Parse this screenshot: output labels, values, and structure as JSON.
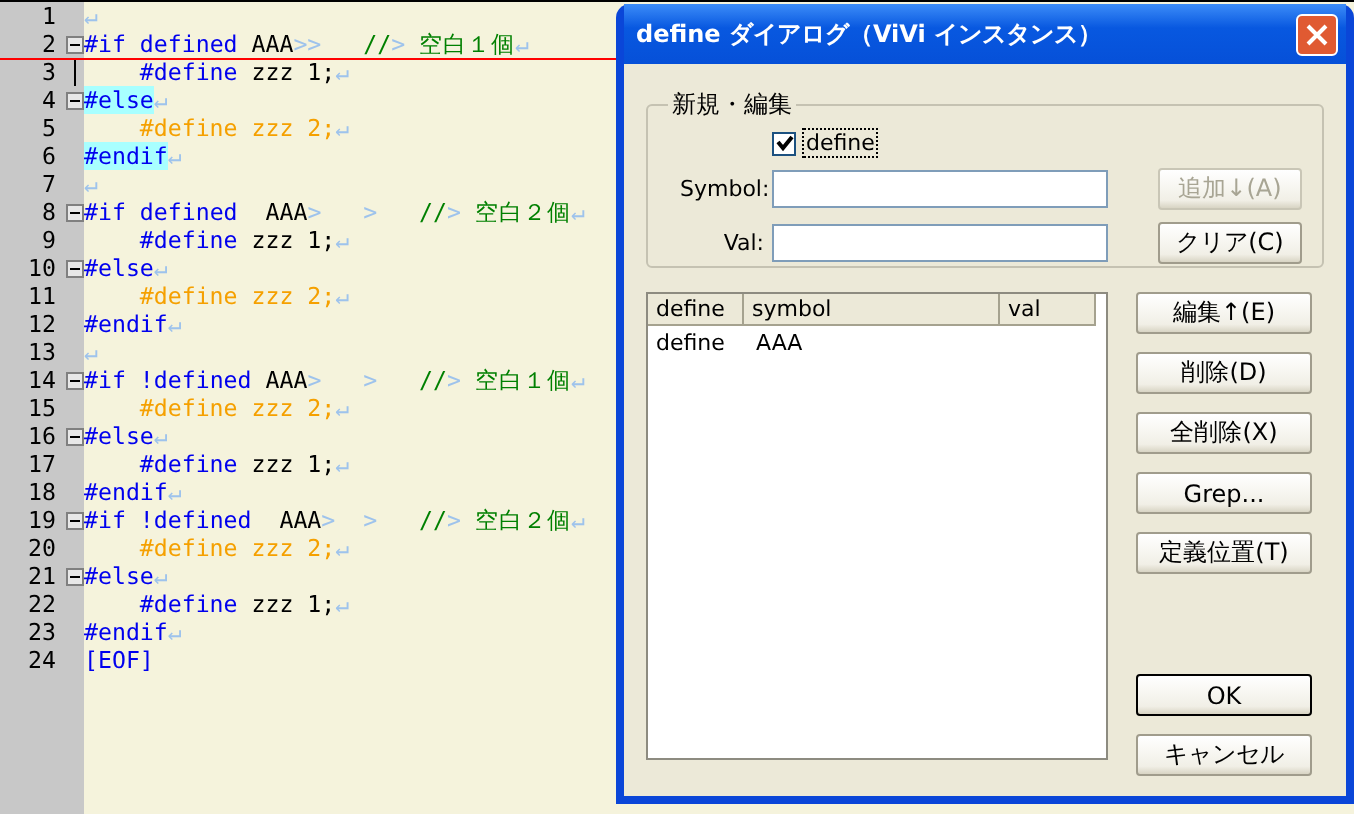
{
  "editor": {
    "lines": [
      {
        "number": "1",
        "fold": false,
        "indent": false,
        "cursor": false,
        "underline": false,
        "segments": [
          {
            "kind": "eol",
            "text": "↵"
          }
        ]
      },
      {
        "number": "2",
        "fold": true,
        "indent": false,
        "cursor": false,
        "underline": true,
        "segments": [
          {
            "kind": "kw",
            "text": "#if defined"
          },
          {
            "kind": "plain",
            "text": " AAA"
          },
          {
            "kind": "tab",
            "text": ">>"
          },
          {
            "kind": "comment",
            "text": "   //"
          },
          {
            "kind": "tab",
            "text": ">"
          },
          {
            "kind": "comment",
            "text": " 空白１個"
          },
          {
            "kind": "eol",
            "text": "↵"
          }
        ]
      },
      {
        "number": "3",
        "fold": false,
        "indent": true,
        "cursor": true,
        "underline": false,
        "segments": [
          {
            "kind": "kw",
            "text": "#define"
          },
          {
            "kind": "plain",
            "text": " zzz 1;"
          },
          {
            "kind": "eol",
            "text": "↵"
          }
        ]
      },
      {
        "number": "4",
        "fold": true,
        "indent": false,
        "cursor": false,
        "underline": false,
        "segments": [
          {
            "kind": "kw",
            "text": "#else",
            "highlight": true
          },
          {
            "kind": "eol",
            "text": "↵"
          }
        ]
      },
      {
        "number": "5",
        "fold": false,
        "indent": true,
        "cursor": false,
        "underline": false,
        "segments": [
          {
            "kind": "off",
            "text": "#define zzz 2;"
          },
          {
            "kind": "eol",
            "text": "↵"
          }
        ]
      },
      {
        "number": "6",
        "fold": false,
        "indent": false,
        "cursor": false,
        "underline": false,
        "segments": [
          {
            "kind": "kw",
            "text": "#endif",
            "highlight": true
          },
          {
            "kind": "eol",
            "text": "↵"
          }
        ]
      },
      {
        "number": "7",
        "fold": false,
        "indent": false,
        "cursor": false,
        "underline": false,
        "segments": [
          {
            "kind": "eol",
            "text": "↵"
          }
        ]
      },
      {
        "number": "8",
        "fold": true,
        "indent": false,
        "cursor": false,
        "underline": false,
        "segments": [
          {
            "kind": "kw",
            "text": "#if defined"
          },
          {
            "kind": "plain",
            "text": "  AAA"
          },
          {
            "kind": "tab",
            "text": ">   >"
          },
          {
            "kind": "comment",
            "text": "   //"
          },
          {
            "kind": "tab",
            "text": ">"
          },
          {
            "kind": "comment",
            "text": " 空白２個"
          },
          {
            "kind": "eol",
            "text": "↵"
          }
        ]
      },
      {
        "number": "9",
        "fold": false,
        "indent": true,
        "cursor": false,
        "underline": false,
        "segments": [
          {
            "kind": "kw",
            "text": "#define"
          },
          {
            "kind": "plain",
            "text": " zzz 1;"
          },
          {
            "kind": "eol",
            "text": "↵"
          }
        ]
      },
      {
        "number": "10",
        "fold": true,
        "indent": false,
        "cursor": false,
        "underline": false,
        "segments": [
          {
            "kind": "kw",
            "text": "#else"
          },
          {
            "kind": "eol",
            "text": "↵"
          }
        ]
      },
      {
        "number": "11",
        "fold": false,
        "indent": true,
        "cursor": false,
        "underline": false,
        "segments": [
          {
            "kind": "off",
            "text": "#define zzz 2;"
          },
          {
            "kind": "eol",
            "text": "↵"
          }
        ]
      },
      {
        "number": "12",
        "fold": false,
        "indent": false,
        "cursor": false,
        "underline": false,
        "segments": [
          {
            "kind": "kw",
            "text": "#endif"
          },
          {
            "kind": "eol",
            "text": "↵"
          }
        ]
      },
      {
        "number": "13",
        "fold": false,
        "indent": false,
        "cursor": false,
        "underline": false,
        "segments": [
          {
            "kind": "eol",
            "text": "↵"
          }
        ]
      },
      {
        "number": "14",
        "fold": true,
        "indent": false,
        "cursor": false,
        "underline": false,
        "segments": [
          {
            "kind": "kw",
            "text": "#if !defined"
          },
          {
            "kind": "plain",
            "text": " AAA"
          },
          {
            "kind": "tab",
            "text": ">   >"
          },
          {
            "kind": "comment",
            "text": "   //"
          },
          {
            "kind": "tab",
            "text": ">"
          },
          {
            "kind": "comment",
            "text": " 空白１個"
          },
          {
            "kind": "eol",
            "text": "↵"
          }
        ]
      },
      {
        "number": "15",
        "fold": false,
        "indent": true,
        "cursor": false,
        "underline": false,
        "segments": [
          {
            "kind": "off",
            "text": "#define zzz 2;"
          },
          {
            "kind": "eol",
            "text": "↵"
          }
        ]
      },
      {
        "number": "16",
        "fold": true,
        "indent": false,
        "cursor": false,
        "underline": false,
        "segments": [
          {
            "kind": "kw",
            "text": "#else"
          },
          {
            "kind": "eol",
            "text": "↵"
          }
        ]
      },
      {
        "number": "17",
        "fold": false,
        "indent": true,
        "cursor": false,
        "underline": false,
        "segments": [
          {
            "kind": "kw",
            "text": "#define"
          },
          {
            "kind": "plain",
            "text": " zzz 1;"
          },
          {
            "kind": "eol",
            "text": "↵"
          }
        ]
      },
      {
        "number": "18",
        "fold": false,
        "indent": false,
        "cursor": false,
        "underline": false,
        "segments": [
          {
            "kind": "kw",
            "text": "#endif"
          },
          {
            "kind": "eol",
            "text": "↵"
          }
        ]
      },
      {
        "number": "19",
        "fold": true,
        "indent": false,
        "cursor": false,
        "underline": false,
        "segments": [
          {
            "kind": "kw",
            "text": "#if !defined"
          },
          {
            "kind": "plain",
            "text": "  AAA"
          },
          {
            "kind": "tab",
            "text": ">  >"
          },
          {
            "kind": "comment",
            "text": "   //"
          },
          {
            "kind": "tab",
            "text": ">"
          },
          {
            "kind": "comment",
            "text": " 空白２個"
          },
          {
            "kind": "eol",
            "text": "↵"
          }
        ]
      },
      {
        "number": "20",
        "fold": false,
        "indent": true,
        "cursor": false,
        "underline": false,
        "segments": [
          {
            "kind": "off",
            "text": "#define zzz 2;"
          },
          {
            "kind": "eol",
            "text": "↵"
          }
        ]
      },
      {
        "number": "21",
        "fold": true,
        "indent": false,
        "cursor": false,
        "underline": false,
        "segments": [
          {
            "kind": "kw",
            "text": "#else"
          },
          {
            "kind": "eol",
            "text": "↵"
          }
        ]
      },
      {
        "number": "22",
        "fold": false,
        "indent": true,
        "cursor": false,
        "underline": false,
        "segments": [
          {
            "kind": "kw",
            "text": "#define"
          },
          {
            "kind": "plain",
            "text": " zzz 1;"
          },
          {
            "kind": "eol",
            "text": "↵"
          }
        ]
      },
      {
        "number": "23",
        "fold": false,
        "indent": false,
        "cursor": false,
        "underline": false,
        "segments": [
          {
            "kind": "kw",
            "text": "#endif"
          },
          {
            "kind": "eol",
            "text": "↵"
          }
        ]
      },
      {
        "number": "24",
        "fold": false,
        "indent": false,
        "cursor": false,
        "underline": false,
        "segments": [
          {
            "kind": "kw",
            "text": "[EOF]"
          }
        ]
      }
    ]
  },
  "dialog": {
    "title": "define ダイアログ（ViVi インスタンス）",
    "group": {
      "title": "新規・編集",
      "checkbox": {
        "label": "define",
        "checked": true,
        "focused": true
      },
      "fields": [
        {
          "label": "Symbol:"
        },
        {
          "label": "Val:"
        }
      ],
      "buttons": [
        {
          "label": "追加↓(A)",
          "disabled": true
        },
        {
          "label": "クリア(C)",
          "disabled": false
        }
      ]
    },
    "list": {
      "columns": [
        "define",
        "symbol",
        "val"
      ],
      "rows": [
        [
          "define",
          "AAA"
        ]
      ]
    },
    "buttons": [
      {
        "label": "編集↑(E)",
        "default": false
      },
      {
        "label": "削除(D)",
        "default": false
      },
      {
        "label": "全削除(X)",
        "default": false
      },
      {
        "label": "Grep...",
        "default": false
      },
      {
        "label": "定義位置(T)",
        "default": false
      }
    ],
    "footer_buttons": [
      {
        "label": "OK",
        "default": true
      },
      {
        "label": "キャンセル",
        "default": false
      }
    ]
  }
}
